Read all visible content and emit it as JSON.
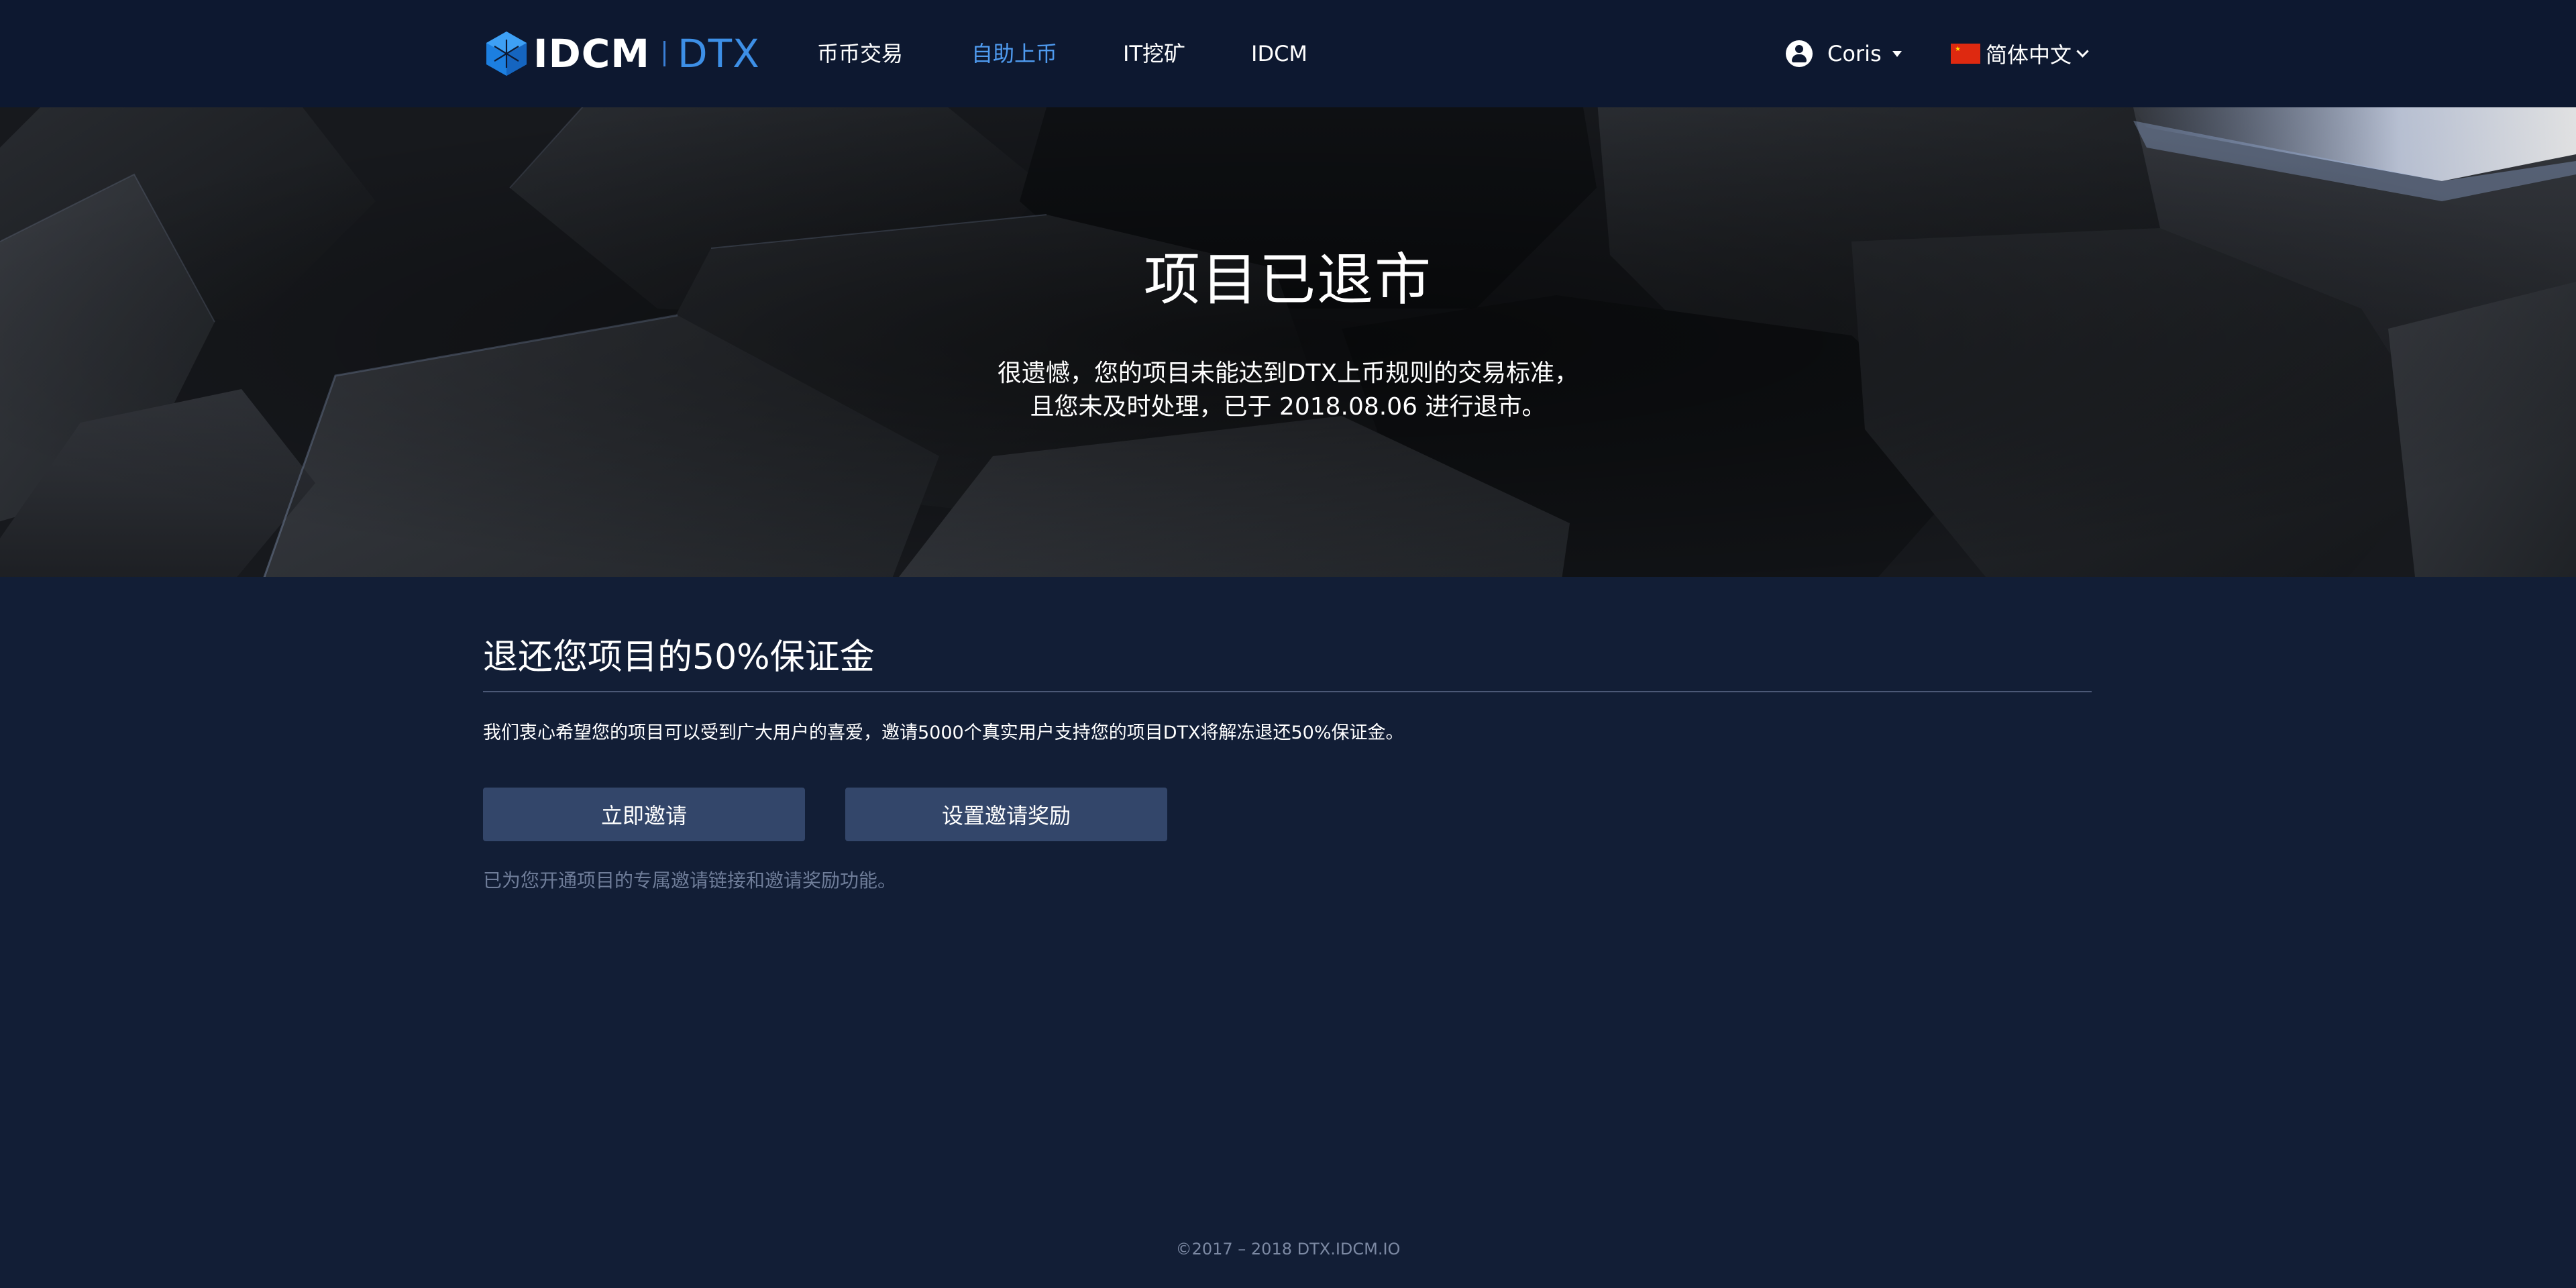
{
  "brand": {
    "name": "IDCM",
    "product": "DTX",
    "accent_color": "#3d8fe6"
  },
  "nav": {
    "items": [
      {
        "label": "币币交易",
        "active": false
      },
      {
        "label": "自助上币",
        "active": true
      },
      {
        "label": "IT挖矿",
        "active": false
      },
      {
        "label": "IDCM",
        "active": false
      }
    ]
  },
  "user": {
    "name": "Coris",
    "icon": "user-icon"
  },
  "language": {
    "label": "简体中文",
    "flag": "china-flag-icon"
  },
  "hero": {
    "title": "项目已退市",
    "line1": "很遗憾，您的项目未能达到DTX上币规则的交易标准，",
    "line2": "且您未及时处理，已于 2018.08.06 进行退市。"
  },
  "refund": {
    "title": "退还您项目的50%保证金",
    "description": "我们衷心希望您的项目可以受到广大用户的喜爱，邀请5000个真实用户支持您的项目DTX将解冻退还50%保证金。",
    "invite_button": "立即邀请",
    "reward_button": "设置邀请奖励",
    "note": "已为您开通项目的专属邀请链接和邀请奖励功能。"
  },
  "footer": {
    "copyright": "©2017 – 2018 DTX.IDCM.IO"
  }
}
